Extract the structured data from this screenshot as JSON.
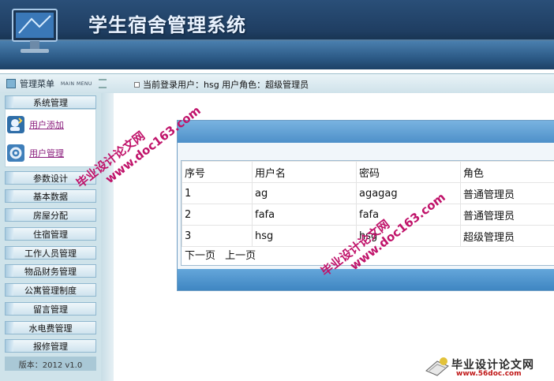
{
  "header": {
    "title": "学生宿舍管理系统"
  },
  "topbar": {
    "menu_label": "管理菜单",
    "menu_sub": "MAIN MENU",
    "login_text": "当前登录用户：hsg  用户角色：超级管理员"
  },
  "sidebar": {
    "top_item": "系统管理",
    "links": [
      "用户添加",
      "用户管理"
    ],
    "items": [
      "参数设计",
      "基本数据",
      "房屋分配",
      "住宿管理",
      "工作人员管理",
      "物品财务管理",
      "公寓管理制度",
      "留言管理",
      "水电费管理",
      "报修管理"
    ],
    "version": "版本：2012 v1.0"
  },
  "table": {
    "headers": [
      "序号",
      "用户名",
      "密码",
      "角色"
    ],
    "rows": [
      [
        "1",
        "ag",
        "agagag",
        "普通管理员"
      ],
      [
        "2",
        "fafa",
        "fafa",
        "普通管理员"
      ],
      [
        "3",
        "hsg",
        "hsg",
        "超级管理员"
      ]
    ]
  },
  "pager": {
    "next": "下一页",
    "prev": "上一页"
  },
  "watermarks": {
    "text1": "毕业设计论文网",
    "text2": "www.doc163.com",
    "logo_text": "毕业设计论文网",
    "logo_url": "www.56doc.com"
  }
}
